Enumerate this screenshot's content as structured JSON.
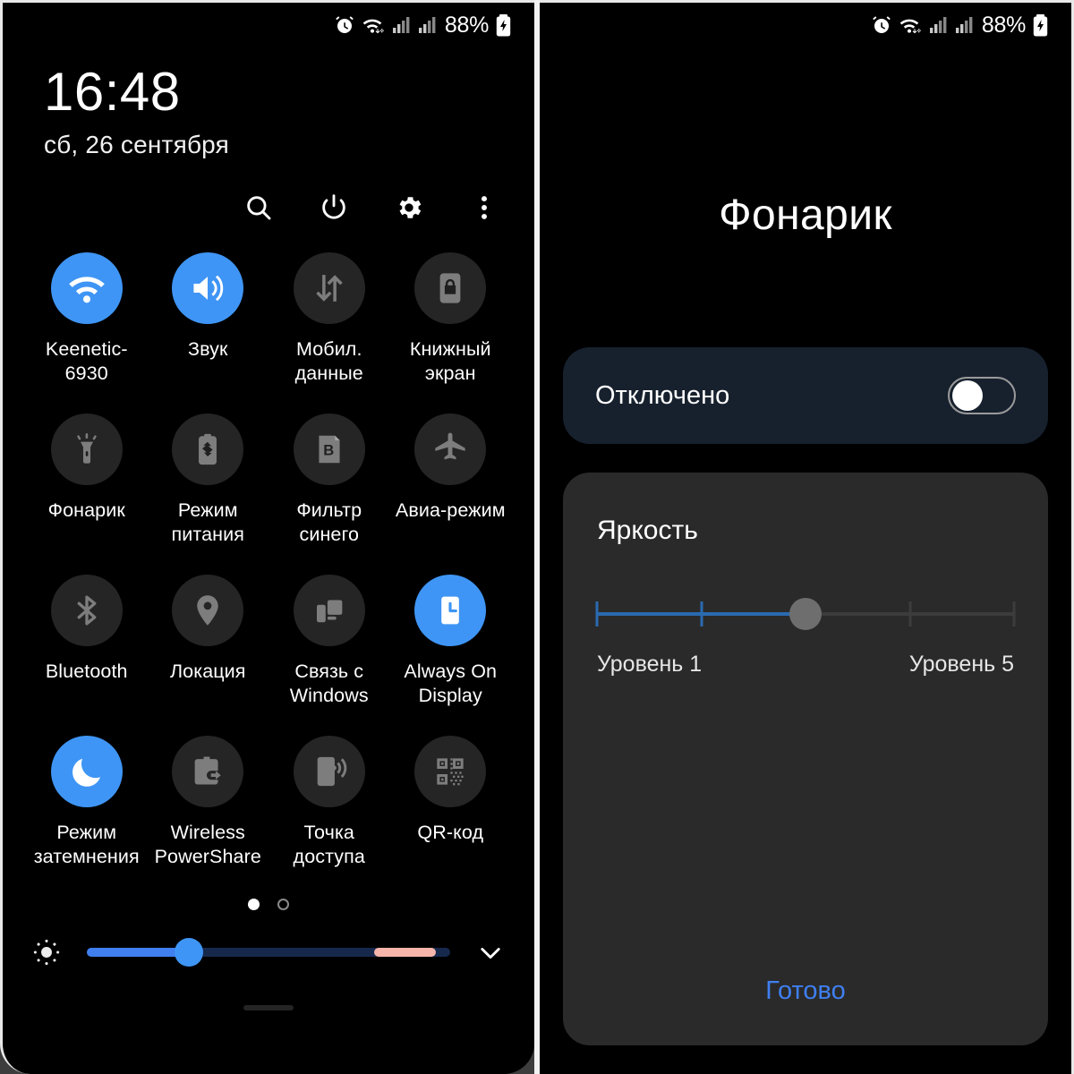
{
  "statusbar": {
    "battery_percent": "88%",
    "icons": [
      "alarm-icon",
      "wifi-icon",
      "signal-sim1-icon",
      "signal-sim2-icon",
      "battery-charging-icon"
    ]
  },
  "left_panel": {
    "clock": {
      "time": "16:48",
      "date": "сб, 26 сентября"
    },
    "actions": [
      {
        "name": "search-icon",
        "label": "Поиск"
      },
      {
        "name": "power-icon",
        "label": "Питание"
      },
      {
        "name": "gear-icon",
        "label": "Настройки"
      },
      {
        "name": "more-vert-icon",
        "label": "Ещё"
      }
    ],
    "tiles": [
      {
        "label": "Keenetic-6930",
        "icon": "wifi-icon",
        "active": true
      },
      {
        "label": "Звук",
        "icon": "volume-icon",
        "active": true
      },
      {
        "label": "Мобил. данные",
        "icon": "data-transfer-icon",
        "active": false
      },
      {
        "label": "Книжный экран",
        "icon": "rotation-lock-icon",
        "active": false
      },
      {
        "label": "Фонарик",
        "icon": "flashlight-icon",
        "active": false
      },
      {
        "label": "Режим питания",
        "icon": "power-mode-icon",
        "active": false
      },
      {
        "label": "Фильтр синего",
        "icon": "blue-light-filter-icon",
        "active": false
      },
      {
        "label": "Авиа-режим",
        "icon": "airplane-icon",
        "active": false
      },
      {
        "label": "Bluetooth",
        "icon": "bluetooth-icon",
        "active": false
      },
      {
        "label": "Локация",
        "icon": "location-pin-icon",
        "active": false
      },
      {
        "label": "Связь с Windows",
        "icon": "link-to-windows-icon",
        "active": false
      },
      {
        "label": "Always On Display",
        "icon": "always-on-display-icon",
        "active": true
      },
      {
        "label": "Режим затемнения",
        "icon": "dark-mode-moon-icon",
        "active": true
      },
      {
        "label": "Wireless PowerShare",
        "icon": "wireless-powershare-icon",
        "active": false
      },
      {
        "label": "Точка доступа",
        "icon": "hotspot-icon",
        "active": false
      },
      {
        "label": "QR-код",
        "icon": "qr-code-icon",
        "active": false
      }
    ],
    "pager": {
      "pages": 2,
      "current": 1
    },
    "brightness": {
      "icon": "brightness-icon",
      "value_percent": 28,
      "warm_start_percent": 79,
      "warm_end_percent": 96,
      "expand_icon": "chevron-down-icon"
    }
  },
  "right_panel": {
    "title": "Фонарик",
    "toggle": {
      "label": "Отключено",
      "on": false
    },
    "brightness_card": {
      "title": "Яркость",
      "min_label": "Уровень 1",
      "max_label": "Уровень 5",
      "levels": 5,
      "value": 3
    },
    "done_label": "Готово"
  },
  "colors": {
    "accent_blue": "#3f95f5",
    "slider_blue": "#3f7ff0",
    "warm_pink": "#f5b5aa",
    "tile_off": "#252525",
    "card_dark_blue": "#17212e",
    "card_gray": "#2a2a2a"
  }
}
